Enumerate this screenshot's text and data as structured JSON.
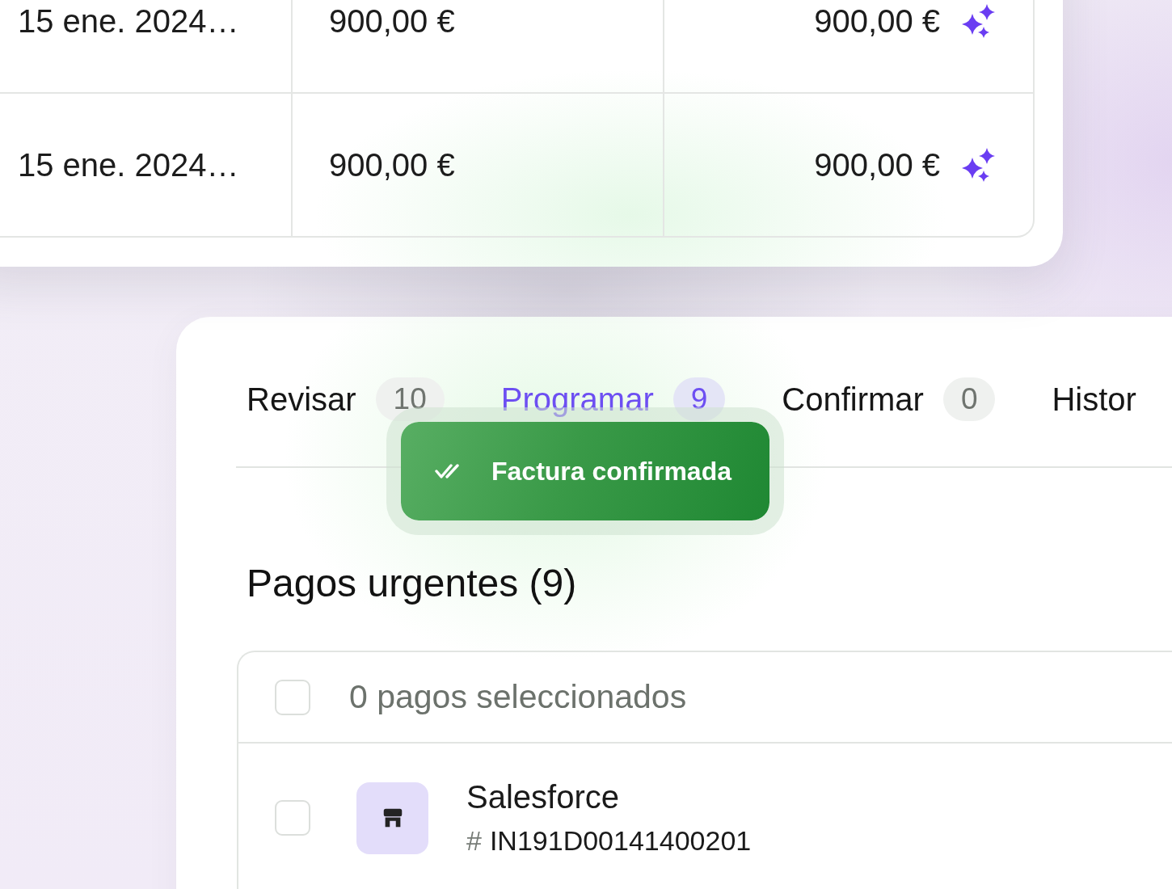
{
  "top_table": {
    "rows": [
      {
        "cells": [
          "15 ene. 2024…",
          "900,00 €",
          "900,00 €"
        ]
      },
      {
        "cells": [
          "15 ene. 2024…",
          "900,00 €",
          "900,00 €"
        ]
      }
    ]
  },
  "tabs": [
    {
      "label": "Revisar",
      "count": "10",
      "selected": false
    },
    {
      "label": "Programar",
      "count": "9",
      "selected": true
    },
    {
      "label": "Confirmar",
      "count": "0",
      "selected": false
    },
    {
      "label": "Histor",
      "selected": false
    }
  ],
  "toast": {
    "text": "Factura confirmada"
  },
  "section": {
    "title": "Pagos urgentes (9)"
  },
  "payments_table": {
    "header": {
      "checked": false,
      "label": "0 pagos seleccionados"
    },
    "rows": [
      {
        "checked": false,
        "vendor": "Salesforce",
        "invoice_prefix": "#",
        "invoice_number": "IN191D00141400201"
      }
    ]
  }
}
